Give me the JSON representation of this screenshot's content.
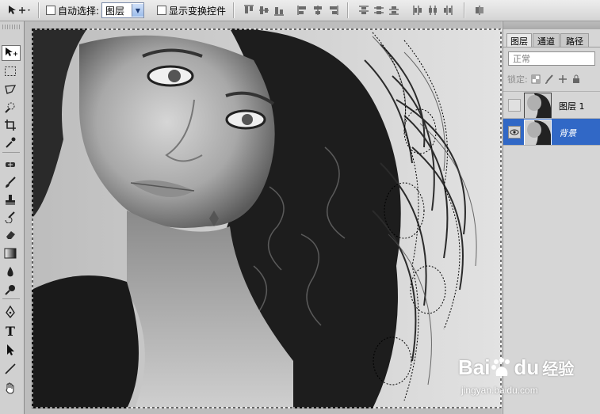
{
  "options_bar": {
    "auto_select_label": "自动选择:",
    "auto_select_value": "图层",
    "show_transform_label": "显示变换控件"
  },
  "layers_panel": {
    "tabs": [
      "图层",
      "通道",
      "路径"
    ],
    "active_tab": "图层",
    "blend_mode": "正常",
    "lock_label": "锁定:",
    "layers": [
      {
        "name": "图层 1",
        "visible": false,
        "selected": false
      },
      {
        "name": "背景",
        "visible": true,
        "selected": true
      }
    ]
  },
  "watermark": {
    "logo_text_a": "Bai",
    "logo_text_b": "du",
    "logo_suffix": "经验",
    "url": "jingyan.baidu.com"
  },
  "colors": {
    "selection_blue": "#3168c6",
    "baidu_blue": "#2932e1",
    "baidu_red": "#e10602"
  }
}
